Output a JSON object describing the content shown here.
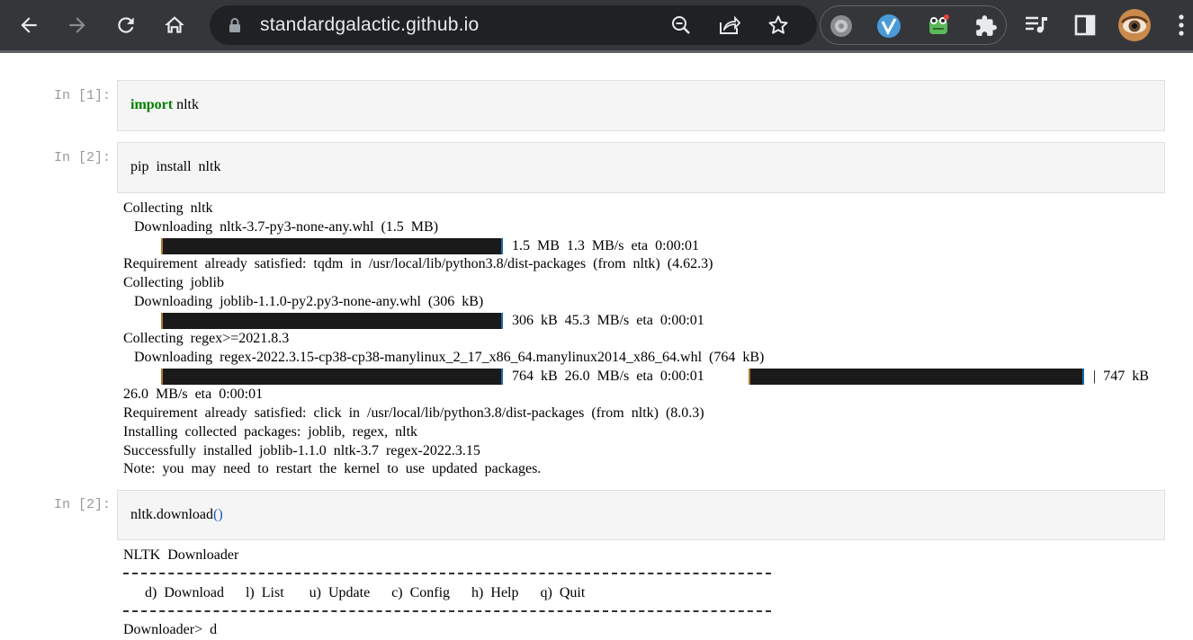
{
  "browser": {
    "url": "standardgalactic.github.io",
    "icons": {
      "back": "arrow-left-icon",
      "forward": "arrow-right-icon",
      "reload": "reload-icon",
      "home": "home-icon",
      "lock": "lock-icon",
      "zoom": "zoom-out-icon",
      "share": "share-icon",
      "bookmark": "star-icon",
      "extensions": "puzzle-icon",
      "media": "media-queue-icon",
      "sidepanel": "side-panel-icon",
      "profile": "profile-avatar",
      "menu": "kebab-menu-icon"
    }
  },
  "notebook": {
    "cells": [
      {
        "prompt": "In [1]:",
        "code_keyword": "import",
        "code_rest": " nltk"
      },
      {
        "prompt": "In [2]:",
        "code": "pip  install  nltk"
      },
      {
        "prompt": "In [2]:",
        "code_func": "nltk.download",
        "code_parens": "()"
      }
    ],
    "pip_output": {
      "l1": "Collecting  nltk",
      "l2": "   Downloading  nltk-3.7-py3-none-any.whl  (1.5  MB)",
      "l3": "1.5  MB  1.3  MB/s  eta  0:00:01",
      "l4": "Requirement  already  satisfied:  tqdm  in  /usr/local/lib/python3.8/dist-packages  (from  nltk)  (4.62.3)",
      "l5": "Collecting  joblib",
      "l6": "   Downloading  joblib-1.1.0-py2.py3-none-any.whl  (306  kB)",
      "l7": "306  kB  45.3  MB/s  eta  0:00:01",
      "l8": "Collecting  regex>=2021.8.3",
      "l9": "   Downloading  regex-2022.3.15-cp38-cp38-manylinux_2_17_x86_64.manylinux2014_x86_64.whl  (764  kB)",
      "l10a": "764  kB  26.0  MB/s  eta  0:00:01",
      "l10b": "|  747  kB",
      "l11": "26.0  MB/s  eta  0:00:01",
      "l12": "Requirement  already  satisfied:  click  in  /usr/local/lib/python3.8/dist-packages  (from  nltk)  (8.0.3)",
      "l13": "Installing  collected  packages:  joblib,  regex,  nltk",
      "l14": "Successfully  installed  joblib-1.1.0  nltk-3.7  regex-2022.3.15",
      "l15": "Note:  you  may  need  to  restart  the  kernel  to  use  updated  packages."
    },
    "downloader_output": {
      "title": "NLTK  Downloader",
      "menu": "      d)  Download      l)  List       u)  Update      c)  Config      h)  Help      q)  Quit",
      "prompt": "Downloader>  d"
    }
  }
}
